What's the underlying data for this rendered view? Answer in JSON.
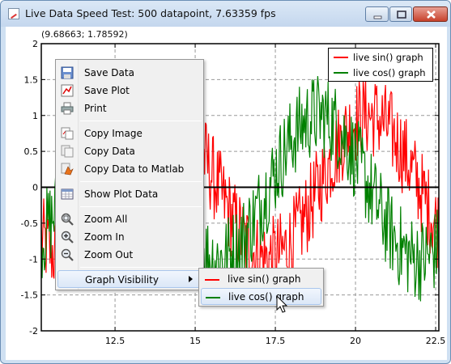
{
  "window": {
    "title": "Live Data Speed Test: 500 datapoint, 7.63359 fps"
  },
  "status": {
    "coordinates": "(9.68663; 1.78592)"
  },
  "legend": {
    "items": [
      {
        "label": "live sin() graph",
        "color": "#ff0000"
      },
      {
        "label": "live cos() graph",
        "color": "#008000"
      }
    ]
  },
  "context_menu": {
    "items": [
      {
        "label": "Save Data",
        "icon": "save-data-icon"
      },
      {
        "label": "Save Plot",
        "icon": "save-plot-icon"
      },
      {
        "label": "Print",
        "icon": "print-icon"
      },
      {
        "label": "Copy Image",
        "icon": "copy-image-icon"
      },
      {
        "label": "Copy Data",
        "icon": "copy-data-icon"
      },
      {
        "label": "Copy Data to Matlab",
        "icon": "matlab-icon"
      },
      {
        "label": "Show Plot Data",
        "icon": "table-icon"
      },
      {
        "label": "Zoom All",
        "icon": "zoom-all-icon"
      },
      {
        "label": "Zoom In",
        "icon": "zoom-in-icon"
      },
      {
        "label": "Zoom Out",
        "icon": "zoom-out-icon"
      },
      {
        "label": "Graph Visibility",
        "icon": "",
        "submenu": true
      }
    ],
    "submenu_items": [
      {
        "label": "live sin() graph",
        "color": "#ff0000"
      },
      {
        "label": "live cos() graph",
        "color": "#008000"
      }
    ]
  },
  "chart_data": {
    "type": "line",
    "x_range": [
      10.2,
      22.6
    ],
    "ylim": [
      -2,
      2
    ],
    "xticks": [
      12.5,
      15,
      17.5,
      20,
      22.5
    ],
    "yticks": [
      -2,
      -1.5,
      -1,
      -0.5,
      0,
      0.5,
      1,
      1.5,
      2
    ],
    "xtick_labels": [
      "12.5",
      "15",
      "17.5",
      "20",
      "22.5"
    ],
    "ytick_labels": [
      "-2",
      "-1.5",
      "-1",
      "-0.5",
      "0",
      "0.5",
      "1",
      "1.5",
      "2"
    ],
    "grid": true,
    "legend_position": "top-right",
    "series": [
      {
        "name": "live sin() graph",
        "function": "sin",
        "noise_amplitude": 0.3,
        "color": "#ff0000"
      },
      {
        "name": "live cos() graph",
        "function": "cos",
        "noise_amplitude": 0.3,
        "color": "#008000"
      }
    ]
  }
}
